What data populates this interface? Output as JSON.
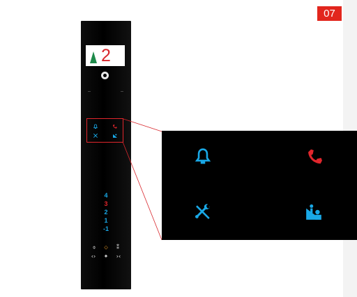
{
  "badge": {
    "label": "07"
  },
  "panel": {
    "display": {
      "floor": "2",
      "direction": "up"
    },
    "floor_buttons": [
      {
        "label": "4",
        "color": "#19a8e6"
      },
      {
        "label": "3",
        "color": "#e0262c"
      },
      {
        "label": "2",
        "color": "#19a8e6"
      },
      {
        "label": "1",
        "color": "#19a8e6"
      },
      {
        "label": "-1",
        "color": "#19a8e6"
      }
    ],
    "control_buttons": {
      "row1": [
        "⌽",
        "⬦",
        "⁑"
      ],
      "row2": [
        "‹›",
        "✦",
        "›‹"
      ]
    },
    "icons": [
      "bell-icon",
      "phone-icon",
      "tools-icon",
      "accessible-icon"
    ]
  },
  "colors": {
    "accent": "#e2261d",
    "icon_blue": "#19a8e6",
    "icon_red": "#e0262c",
    "bell_button": "#e89a2a"
  }
}
